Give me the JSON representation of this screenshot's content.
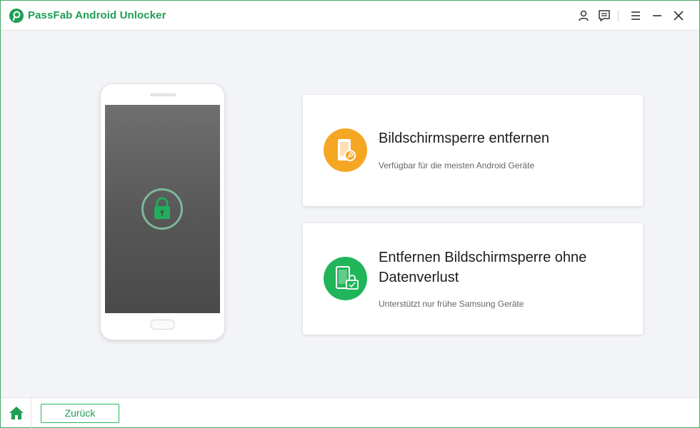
{
  "app": {
    "title": "PassFab Android Unlocker",
    "accent_color": "#1f9d55",
    "background": "#f3f4f7"
  },
  "titlebar": {
    "icons": [
      "user-icon",
      "feedback-icon",
      "menu-icon",
      "minimize-icon",
      "close-icon"
    ]
  },
  "phone": {
    "screen_icon": "lock-icon"
  },
  "options": [
    {
      "title": "Bildschirmsperre entfernen",
      "subtitle": "Verfügbar für die meisten Android Geräte",
      "icon": "phone-key-icon",
      "icon_color": "#f5a623"
    },
    {
      "title": "Entfernen Bildschirmsperre ohne Datenverlust",
      "subtitle": "Unterstützt nur frühe Samsung Geräte",
      "icon": "phone-lock-icon",
      "icon_color": "#20b55a"
    }
  ],
  "footer": {
    "home_icon": "home-icon",
    "back_label": "Zurück"
  }
}
